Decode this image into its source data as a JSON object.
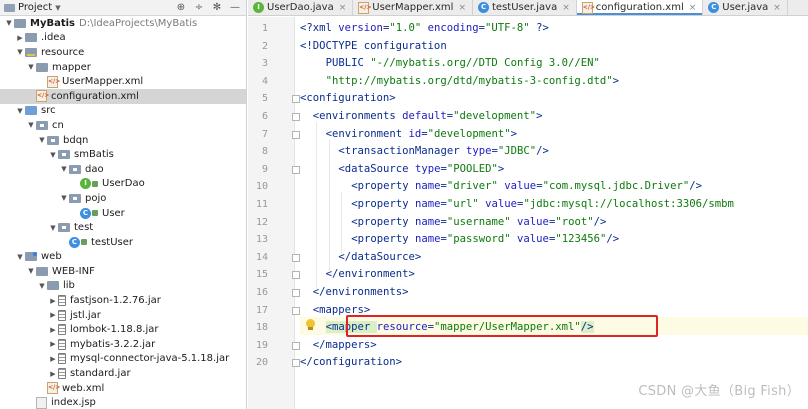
{
  "project_panel": {
    "title": "Project",
    "tools": [
      "⊕",
      "÷",
      "✻",
      "—"
    ],
    "tree": [
      {
        "depth": 0,
        "arrow": "▼",
        "icon": "proj",
        "label": "MyBatis",
        "bold": true,
        "suffix": "D:\\IdeaProjects\\MyBatis"
      },
      {
        "depth": 1,
        "arrow": "▶",
        "icon": "folder",
        "label": ".idea"
      },
      {
        "depth": 1,
        "arrow": "▼",
        "icon": "folder res",
        "label": "resource"
      },
      {
        "depth": 2,
        "arrow": "▼",
        "icon": "folder",
        "label": "mapper"
      },
      {
        "depth": 3,
        "arrow": "",
        "icon": "xml",
        "label": "UserMapper.xml"
      },
      {
        "depth": 2,
        "arrow": "",
        "icon": "xml",
        "label": "configuration.xml",
        "selected": true
      },
      {
        "depth": 1,
        "arrow": "▼",
        "icon": "folder src",
        "label": "src"
      },
      {
        "depth": 2,
        "arrow": "▼",
        "icon": "folder pkg",
        "label": "cn"
      },
      {
        "depth": 3,
        "arrow": "▼",
        "icon": "folder pkg",
        "label": "bdqn"
      },
      {
        "depth": 4,
        "arrow": "▼",
        "icon": "folder pkg",
        "label": "smBatis"
      },
      {
        "depth": 5,
        "arrow": "▼",
        "icon": "folder pkg",
        "label": "dao"
      },
      {
        "depth": 6,
        "arrow": "",
        "icon": "class-i",
        "label": "UserDao",
        "lock": true
      },
      {
        "depth": 5,
        "arrow": "▼",
        "icon": "folder pkg",
        "label": "pojo"
      },
      {
        "depth": 6,
        "arrow": "",
        "icon": "class-c",
        "label": "User",
        "lock": true
      },
      {
        "depth": 4,
        "arrow": "▼",
        "icon": "folder pkg",
        "label": "test"
      },
      {
        "depth": 5,
        "arrow": "",
        "icon": "class-c",
        "label": "testUser",
        "lock": true
      },
      {
        "depth": 1,
        "arrow": "▼",
        "icon": "folder web",
        "label": "web"
      },
      {
        "depth": 2,
        "arrow": "▼",
        "icon": "folder",
        "label": "WEB-INF"
      },
      {
        "depth": 3,
        "arrow": "▼",
        "icon": "folder",
        "label": "lib"
      },
      {
        "depth": 4,
        "arrow": "▶",
        "icon": "jar",
        "label": "fastjson-1.2.76.jar"
      },
      {
        "depth": 4,
        "arrow": "▶",
        "icon": "jar",
        "label": "jstl.jar"
      },
      {
        "depth": 4,
        "arrow": "▶",
        "icon": "jar",
        "label": "lombok-1.18.8.jar"
      },
      {
        "depth": 4,
        "arrow": "▶",
        "icon": "jar",
        "label": "mybatis-3.2.2.jar"
      },
      {
        "depth": 4,
        "arrow": "▶",
        "icon": "jar",
        "label": "mysql-connector-java-5.1.18.jar"
      },
      {
        "depth": 4,
        "arrow": "▶",
        "icon": "jar",
        "label": "standard.jar"
      },
      {
        "depth": 3,
        "arrow": "",
        "icon": "xml",
        "label": "web.xml"
      },
      {
        "depth": 2,
        "arrow": "",
        "icon": "jsp",
        "label": "index.jsp"
      }
    ]
  },
  "tabs": [
    {
      "icon": "class-i",
      "label": "UserDao.java",
      "active": false
    },
    {
      "icon": "xml",
      "label": "UserMapper.xml",
      "active": false
    },
    {
      "icon": "class-c",
      "label": "testUser.java",
      "active": false
    },
    {
      "icon": "xml",
      "label": "configuration.xml",
      "active": true
    },
    {
      "icon": "class-c",
      "label": "User.java",
      "active": false
    }
  ],
  "editor": {
    "lines": [
      {
        "n": "1",
        "indent": 0,
        "parts": [
          [
            "pi",
            "<?xml "
          ],
          [
            "attr",
            "version"
          ],
          [
            "pi",
            "="
          ],
          [
            "val",
            "\"1.0\""
          ],
          [
            "pi",
            " "
          ],
          [
            "attr",
            "encoding"
          ],
          [
            "pi",
            "="
          ],
          [
            "val",
            "\"UTF-8\""
          ],
          [
            "pi",
            " ?>"
          ]
        ]
      },
      {
        "n": "2",
        "indent": 0,
        "parts": [
          [
            "dt",
            "<!DOCTYPE configuration"
          ]
        ]
      },
      {
        "n": "3",
        "indent": 4,
        "parts": [
          [
            "dt",
            "PUBLIC "
          ],
          [
            "str",
            "\"-//mybatis.org//DTD Config 3.0//EN\""
          ]
        ]
      },
      {
        "n": "4",
        "indent": 4,
        "parts": [
          [
            "str",
            "\"http://mybatis.org/dtd/mybatis-3-config.dtd\""
          ],
          [
            "dt",
            ">"
          ]
        ]
      },
      {
        "n": "5",
        "indent": 0,
        "parts": [
          [
            "tag",
            "<configuration>"
          ]
        ]
      },
      {
        "n": "6",
        "indent": 2,
        "parts": [
          [
            "tag",
            "<environments "
          ],
          [
            "attr",
            "default"
          ],
          [
            "tag",
            "="
          ],
          [
            "val",
            "\"development\""
          ],
          [
            "tag",
            ">"
          ]
        ]
      },
      {
        "n": "7",
        "indent": 4,
        "parts": [
          [
            "tag",
            "<environment "
          ],
          [
            "attr",
            "id"
          ],
          [
            "tag",
            "="
          ],
          [
            "val",
            "\"development\""
          ],
          [
            "tag",
            ">"
          ]
        ]
      },
      {
        "n": "8",
        "indent": 6,
        "parts": [
          [
            "tag",
            "<transactionManager "
          ],
          [
            "attr",
            "type"
          ],
          [
            "tag",
            "="
          ],
          [
            "val",
            "\"JDBC\""
          ],
          [
            "tag",
            "/>"
          ]
        ]
      },
      {
        "n": "9",
        "indent": 6,
        "parts": [
          [
            "tag",
            "<dataSource "
          ],
          [
            "attr",
            "type"
          ],
          [
            "tag",
            "="
          ],
          [
            "val",
            "\"POOLED\""
          ],
          [
            "tag",
            ">"
          ]
        ]
      },
      {
        "n": "10",
        "indent": 8,
        "parts": [
          [
            "tag",
            "<property "
          ],
          [
            "attr",
            "name"
          ],
          [
            "tag",
            "="
          ],
          [
            "val",
            "\"driver\""
          ],
          [
            "tag",
            " "
          ],
          [
            "attr",
            "value"
          ],
          [
            "tag",
            "="
          ],
          [
            "val",
            "\"com.mysql.jdbc.Driver\""
          ],
          [
            "tag",
            "/>"
          ]
        ]
      },
      {
        "n": "11",
        "indent": 8,
        "parts": [
          [
            "tag",
            "<property "
          ],
          [
            "attr",
            "name"
          ],
          [
            "tag",
            "="
          ],
          [
            "val",
            "\"url\""
          ],
          [
            "tag",
            " "
          ],
          [
            "attr",
            "value"
          ],
          [
            "tag",
            "="
          ],
          [
            "val",
            "\"jdbc:mysql://localhost:3306/smbm"
          ]
        ]
      },
      {
        "n": "12",
        "indent": 8,
        "parts": [
          [
            "tag",
            "<property "
          ],
          [
            "attr",
            "name"
          ],
          [
            "tag",
            "="
          ],
          [
            "val",
            "\"username\""
          ],
          [
            "tag",
            " "
          ],
          [
            "attr",
            "value"
          ],
          [
            "tag",
            "="
          ],
          [
            "val",
            "\"root\""
          ],
          [
            "tag",
            "/>"
          ]
        ]
      },
      {
        "n": "13",
        "indent": 8,
        "parts": [
          [
            "tag",
            "<property "
          ],
          [
            "attr",
            "name"
          ],
          [
            "tag",
            "="
          ],
          [
            "val",
            "\"password\""
          ],
          [
            "tag",
            " "
          ],
          [
            "attr",
            "value"
          ],
          [
            "tag",
            "="
          ],
          [
            "val",
            "\"123456\""
          ],
          [
            "tag",
            "/>"
          ]
        ]
      },
      {
        "n": "14",
        "indent": 6,
        "parts": [
          [
            "tag",
            "</dataSource>"
          ]
        ]
      },
      {
        "n": "15",
        "indent": 4,
        "parts": [
          [
            "tag",
            "</environment>"
          ]
        ]
      },
      {
        "n": "16",
        "indent": 2,
        "parts": [
          [
            "tag",
            "</environments>"
          ]
        ]
      },
      {
        "n": "17",
        "indent": 2,
        "parts": [
          [
            "tag",
            "<mappers>"
          ]
        ]
      },
      {
        "n": "18",
        "indent": 4,
        "parts": [
          [
            "tag hl-tag-green",
            "<mapper "
          ],
          [
            "attr",
            "resource"
          ],
          [
            "tag",
            "="
          ],
          [
            "val",
            "\"mapper/UserMapper.xml\""
          ],
          [
            "tag hl-tag-green",
            "/>"
          ]
        ]
      },
      {
        "n": "19",
        "indent": 2,
        "parts": [
          [
            "tag",
            "</mappers>"
          ]
        ]
      },
      {
        "n": "20",
        "indent": 0,
        "parts": [
          [
            "tag",
            "</configuration>"
          ]
        ]
      }
    ]
  },
  "watermark": "CSDN @大鱼（Big Fish）"
}
